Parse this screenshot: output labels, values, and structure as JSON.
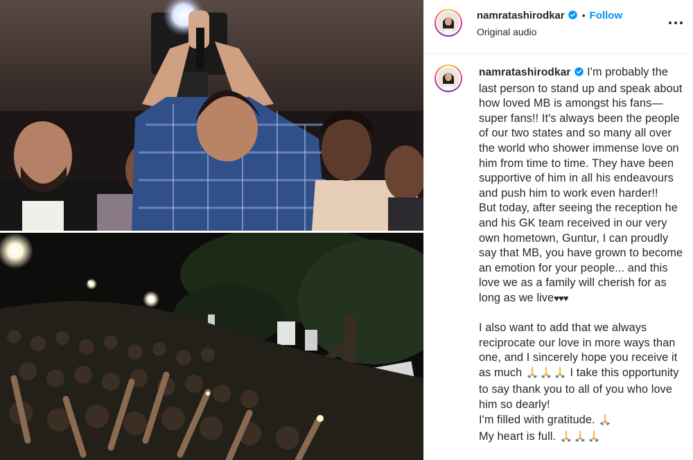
{
  "post": {
    "username": "namratashirodkar",
    "follow_label": "Follow",
    "separator": "•",
    "audio_label": "Original audio"
  },
  "caption": {
    "username": "namratashirodkar",
    "p1_text": " I'm probably the last person to stand up and speak about how loved MB is amongst his fans—super fans!! It's always been the people of our two states and so many all over the world who shower immense love on him from time to time. They have been supportive of him in all his endeavours and push him to work even harder!!",
    "p2_text": "But today, after seeing the reception he and his GK team received in our very own hometown, Guntur, I can proudly say that MB, you have grown to become an emotion for your people... and this love we as a family will cherish for as long as we live",
    "hearts": "♥♥♥",
    "p3_a": "I also want to add that we always reciprocate our love in more ways than one, and I sincerely hope you receive it as much ",
    "p3_b": " I take this opportunity to say thank you to all of you who love him so dearly!",
    "p4": "I'm filled with gratitude. ",
    "p5": "My heart is full. "
  },
  "colors": {
    "accent": "#0095f6",
    "text": "#262626",
    "verified": "#0095f6"
  },
  "icons": [
    "verified-badge-icon",
    "more-options-icon",
    "praying-hands-icon"
  ]
}
